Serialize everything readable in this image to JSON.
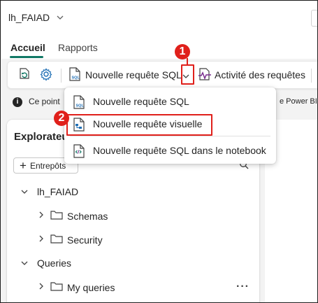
{
  "titlebar": {
    "workspace_name": "lh_FAIAD"
  },
  "tabs": [
    {
      "label": "Accueil",
      "active": true
    },
    {
      "label": "Rapports",
      "active": false
    }
  ],
  "ribbon": {
    "new_sql_query_label": "Nouvelle requête SQL",
    "query_activity_label": "Activité des requêtes"
  },
  "infobar": {
    "text": "Ce point",
    "text_right": "e Power BI"
  },
  "explorer": {
    "title": "Explorateu",
    "add_button_label": "Entrepôts",
    "tree": [
      {
        "label": "lh_FAIAD",
        "level": 0,
        "expanded": true
      },
      {
        "label": "Schemas",
        "level": 1,
        "expanded": false
      },
      {
        "label": "Security",
        "level": 1,
        "expanded": false
      },
      {
        "label": "Queries",
        "level": 0,
        "expanded": true
      },
      {
        "label": "My queries",
        "level": 1,
        "expanded": false
      }
    ]
  },
  "dropdown_menu": {
    "items": [
      {
        "label": "Nouvelle requête SQL",
        "icon": "sql-file-icon"
      },
      {
        "label": "Nouvelle requête visuelle",
        "icon": "visual-query-icon"
      },
      {
        "label": "Nouvelle requête SQL dans le notebook",
        "icon": "notebook-icon"
      }
    ]
  },
  "callouts": {
    "step1": "1",
    "step2": "2"
  },
  "colors": {
    "accent": "#117865",
    "highlight": "#e0201b",
    "icon_blue": "#1f6fb5",
    "icon_purple": "#7a2f8f"
  }
}
